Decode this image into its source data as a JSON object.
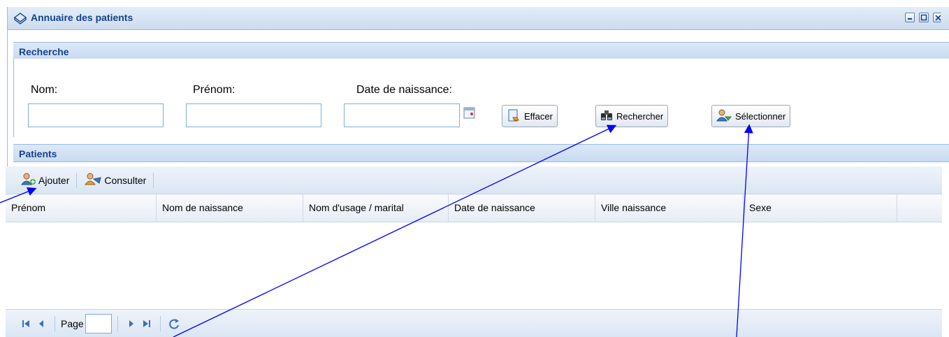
{
  "window": {
    "title": "Annuaire des patients",
    "controls": [
      "minimize-icon",
      "maximize-icon",
      "close-icon"
    ]
  },
  "search": {
    "header": "Recherche",
    "fields": {
      "nom_label": "Nom:",
      "prenom_label": "Prénom:",
      "date_label": "Date de naissance:",
      "nom_value": "",
      "prenom_value": "",
      "date_value": ""
    },
    "buttons": {
      "effacer": "Effacer",
      "rechercher": "Rechercher",
      "selectionner": "Sélectionner"
    }
  },
  "patients": {
    "header": "Patients",
    "toolbar": {
      "ajouter": "Ajouter",
      "consulter": "Consulter"
    },
    "columns": [
      "Prénom",
      "Nom de naissance",
      "Nom d'usage / marital",
      "Date de naissance",
      "Ville naissance",
      "Sexe"
    ],
    "rows": [],
    "pager": {
      "page_label": "Page",
      "page_value": ""
    }
  },
  "colors": {
    "accent": "#15428b",
    "border": "#99bbe8",
    "annotation_arrows": "#0000ff"
  }
}
